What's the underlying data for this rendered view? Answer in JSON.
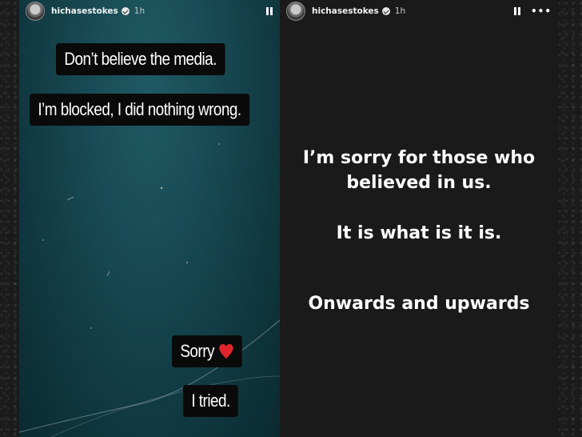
{
  "left_story": {
    "username": "hichasestokes",
    "time": "1h",
    "captions": [
      "Don’t believe the media.",
      "I’m blocked, I did nothing wrong.",
      "Sorry",
      "I tried."
    ],
    "background_color": "#184a54"
  },
  "right_story": {
    "username": "hichasestokes",
    "time": "1h",
    "more": "•••",
    "lines": [
      "I’m sorry for those who",
      "believed in us.",
      "It is what is it is.",
      "Onwards and upwards"
    ],
    "background_color": "#1a1a1a"
  },
  "icons": {
    "verified": "verified-badge-icon",
    "pause": "pause-icon",
    "more": "more-options-icon",
    "heart": "red-heart-icon",
    "heart_color": "#e0242b"
  }
}
